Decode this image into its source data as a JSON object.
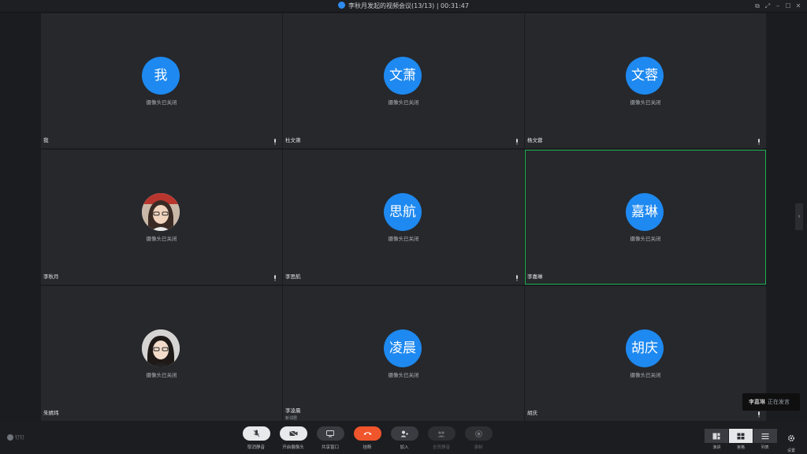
{
  "window": {
    "title": "李秋月发起的视频会议(13/13) | 00:31:47"
  },
  "tiles": [
    {
      "name": "我",
      "avatar_text": "我",
      "status": "摄像头已关闭"
    },
    {
      "name": "杜文萧",
      "avatar_text": "文萧",
      "status": "摄像头已关闭"
    },
    {
      "name": "杨文蓉",
      "avatar_text": "文蓉",
      "status": "摄像头已关闭"
    },
    {
      "name": "李秋月",
      "avatar_text": "",
      "status": "摄像头已关闭"
    },
    {
      "name": "李思航",
      "avatar_text": "思航",
      "status": "摄像头已关闭"
    },
    {
      "name": "李嘉琳",
      "avatar_text": "嘉琳",
      "status": "摄像头已关闭"
    },
    {
      "name": "朱婧玮",
      "avatar_text": "",
      "status": "摄像头已关闭"
    },
    {
      "name": "李凌晨",
      "sub": "新邻居",
      "avatar_text": "凌晨",
      "status": "摄像头已关闭"
    },
    {
      "name": "胡庆",
      "avatar_text": "胡庆",
      "status": "摄像头已关闭"
    }
  ],
  "speaking": {
    "who": "李嘉琳",
    "what": "正在发言"
  },
  "brand": "钉钉",
  "toolbar": {
    "unmute": "取消静音",
    "camera_on": "开启摄像头",
    "share_window": "共享窗口",
    "hang_up": "挂断",
    "join": "加入",
    "mute_all": "全员静音",
    "record": "录制"
  },
  "views": {
    "speaker": "演讲",
    "gallery": "宫格",
    "list": "列表",
    "settings": "设置"
  },
  "colors": {
    "avatar_blue": "#1e89f0",
    "active_border": "#1eb050",
    "hangup_red": "#f0552c"
  }
}
